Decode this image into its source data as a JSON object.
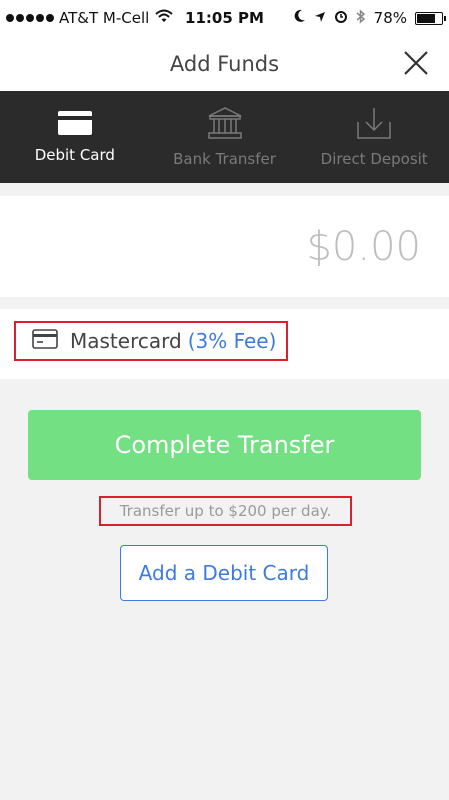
{
  "status_bar": {
    "carrier": "AT&T M-Cell",
    "time": "11:05 PM",
    "battery": "78%",
    "battery_level": 0.78,
    "signal_bars": 5
  },
  "header": {
    "title": "Add Funds",
    "close_icon": "close-icon"
  },
  "tabs": [
    {
      "label": "Debit Card",
      "icon": "debit-card-icon",
      "active": true
    },
    {
      "label": "Bank Transfer",
      "icon": "bank-icon",
      "active": false
    },
    {
      "label": "Direct Deposit",
      "icon": "download-tray-icon",
      "active": false
    }
  ],
  "amount": {
    "value": "$0.00"
  },
  "card": {
    "name": "Mastercard",
    "fee": "(3% Fee)",
    "icon": "card-icon"
  },
  "actions": {
    "complete_label": "Complete Transfer",
    "limit_note": "Transfer up to $200 per day.",
    "add_card_label": "Add a Debit Card"
  },
  "colors": {
    "complete_button": "#72e083",
    "accent_blue": "#3d7be0",
    "highlight_red": "#d9202c",
    "tab_bar": "#2b2b2b"
  }
}
